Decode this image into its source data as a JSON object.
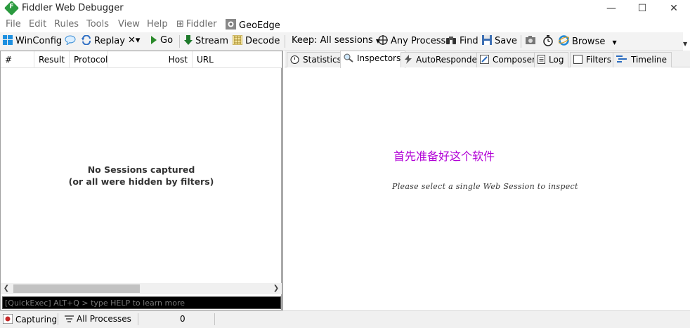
{
  "window": {
    "title": "Fiddler Web Debugger",
    "minimize": "—",
    "maximize": "☐",
    "close": "✕"
  },
  "menu": [
    "File",
    "Edit",
    "Rules",
    "Tools",
    "View",
    "Help",
    "Fiddler",
    "GeoEdge"
  ],
  "toolbar": {
    "winconfig": "WinConfig",
    "replay": "Replay",
    "remove": "✕▾",
    "go": "Go",
    "stream": "Stream",
    "decode": "Decode",
    "keep": "Keep: All sessions",
    "process": "Any Process",
    "find": "Find",
    "save": "Save",
    "browse": "Browse"
  },
  "sessions": {
    "columns": [
      "#",
      "Result",
      "Protocol",
      "Host",
      "URL"
    ],
    "empty_line1": "No Sessions captured",
    "empty_line2": "(or all were hidden by filters)"
  },
  "quickexec": {
    "placeholder": "[QuickExec] ALT+Q > type HELP to learn more"
  },
  "tabs": [
    "Statistics",
    "Inspectors",
    "AutoResponder",
    "Composer",
    "Log",
    "Filters",
    "Timeline"
  ],
  "active_tab": "Inspectors",
  "inspector": {
    "annotation": "首先准备好这个软件",
    "hint": "Please select a single Web Session to inspect"
  },
  "status": {
    "capturing": "Capturing",
    "processes": "All Processes",
    "count": "0"
  },
  "colors": {
    "accent_annotation": "#b100d6",
    "app_icon": "#2b9a3f",
    "quickexec_bg": "#000000"
  }
}
